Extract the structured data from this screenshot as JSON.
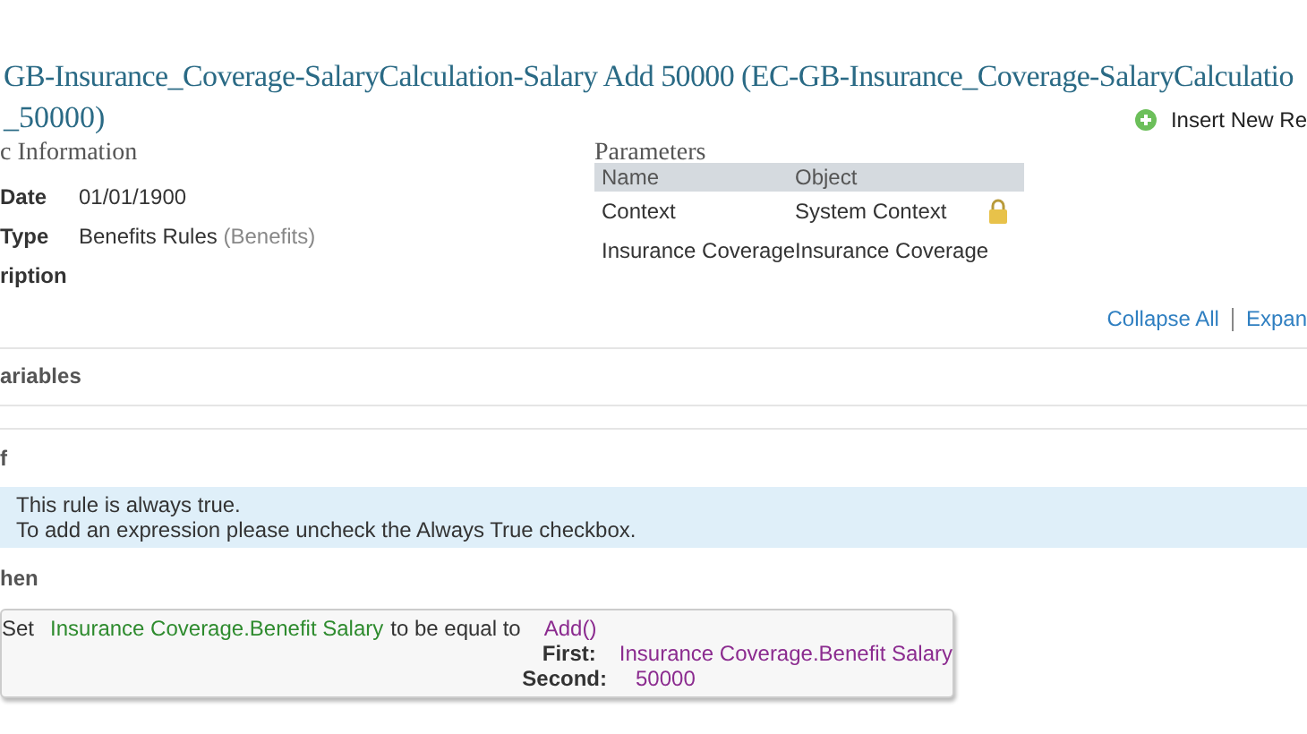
{
  "title": {
    "line_1": "GB-Insurance_Coverage-SalaryCalculation-Salary Add 50000 (EC-GB-Insurance_Coverage-SalaryCalculatio",
    "line_2": "_50000)"
  },
  "insert_button": "Insert New Re",
  "basic_information": {
    "heading": "c Information",
    "fields": [
      {
        "label": "Date",
        "value": "01/01/1900"
      },
      {
        "label": "Type",
        "value": "Benefits Rules",
        "note": "(Benefits)"
      },
      {
        "label": "ription"
      }
    ]
  },
  "parameters": {
    "heading": "Parameters",
    "columns": [
      "Name",
      "Object"
    ],
    "rows": [
      {
        "name": "Context",
        "object": "System Context",
        "locked": true
      },
      {
        "name": "Insurance Coverage",
        "object": "Insurance Coverage",
        "locked": false
      }
    ]
  },
  "links": [
    "Collapse All",
    "Expan"
  ],
  "variables": {
    "heading": "ariables"
  },
  "if": {
    "heading": "f",
    "message": [
      "This rule is always true.",
      "To add an expression please uncheck the Always True checkbox."
    ]
  },
  "then": {
    "heading": "hen",
    "statement": {
      "verb": "Set",
      "target": "Insurance Coverage.Benefit Salary",
      "operator": "to be equal to",
      "function": "Add()",
      "arguments": [
        {
          "label": "First:",
          "value": "Insurance Coverage.Benefit Salary"
        },
        {
          "label": "Second:",
          "value": "50000"
        }
      ]
    }
  }
}
